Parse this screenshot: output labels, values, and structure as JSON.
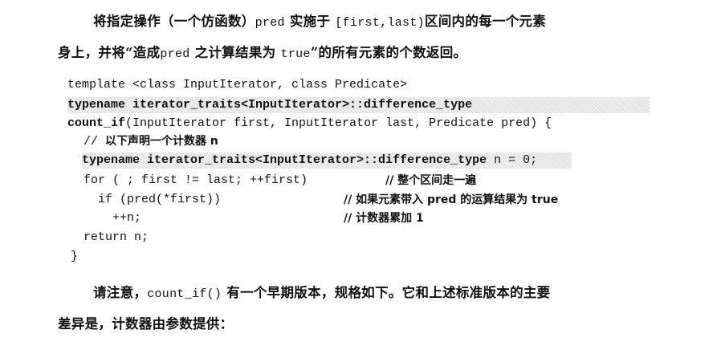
{
  "intro": {
    "line1": {
      "a": "将指定操作（一个仿函数）",
      "b": "pred",
      "c": "实施于",
      "d": "[first,last)",
      "e": "区间内的每一个元素"
    },
    "line2": {
      "a": "身上，并将“造成",
      "b": "pred",
      "c": "之计算结果为",
      "d": "true",
      "e": "”的所有元素的个数返回。"
    }
  },
  "code": {
    "line1": "template <class InputIterator, class Predicate>",
    "line2": "typename iterator_traits<InputIterator>::difference_type",
    "line3a": "count_if",
    "line3b": "(InputIterator first, InputIterator last, Predicate pred) {",
    "line4a": "// ",
    "line4b": "以下声明一个计数器 n",
    "line5a": "typename iterator_traits<InputIterator>::difference_type",
    "line5b": " n = 0;",
    "line6a": "for ( ; first != last; ++first)",
    "line6b": "// 整个区间走一遍",
    "line7a": "if (pred(*first))",
    "line7b": "// 如果元素带入 pred 的运算结果为 true",
    "line8a": "++n;",
    "line8b": "// 计数器累加 1",
    "line9": "return n;",
    "line10": "}"
  },
  "outro": {
    "line1": {
      "a": "请注意，",
      "b": "count_if()",
      "c": "有一个早期版本，规格如下。它和上述标准版本的主要"
    },
    "line2": "差异是，计数器由参数提供："
  }
}
